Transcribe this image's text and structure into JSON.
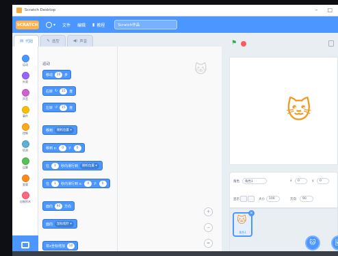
{
  "window": {
    "title": "Scratch Desktop",
    "minimize_label": "–",
    "maximize_label": "□"
  },
  "menubar": {
    "logo_label": "SCRATCH",
    "file_label": "文件",
    "edit_label": "编辑",
    "tutorials_label": "教程",
    "project_title_value": "Scratch作品"
  },
  "tabs": [
    {
      "label": "代码"
    },
    {
      "label": "造型"
    },
    {
      "label": "声音"
    }
  ],
  "categories": [
    {
      "label": "运动",
      "color": "#4c97ff"
    },
    {
      "label": "外观",
      "color": "#9966ff"
    },
    {
      "label": "声音",
      "color": "#cf63cf"
    },
    {
      "label": "事件",
      "color": "#ffbf00"
    },
    {
      "label": "控制",
      "color": "#ffab19"
    },
    {
      "label": "侦测",
      "color": "#5cb1d6"
    },
    {
      "label": "运算",
      "color": "#59c059"
    },
    {
      "label": "变量",
      "color": "#ff8c1a"
    },
    {
      "label": "自制积木",
      "color": "#ff6680"
    }
  ],
  "palette": {
    "title": "运动",
    "blocks": {
      "move": {
        "prefix": "移动",
        "value": "10",
        "suffix": "步"
      },
      "turn_right": {
        "prefix": "右转",
        "icon": "↻",
        "value": "15",
        "suffix": "度"
      },
      "turn_left": {
        "prefix": "左转",
        "icon": "↺",
        "value": "15",
        "suffix": "度"
      },
      "goto": {
        "prefix": "移到",
        "dropdown": "随机位置"
      },
      "goto_xy": {
        "prefix": "移到 x:",
        "x": "0",
        "mid": "y:",
        "y": "0"
      },
      "glide_to": {
        "prefix": "在",
        "value": "1",
        "mid": "秒内滑行到",
        "dropdown": "随机位置"
      },
      "glide_xy": {
        "prefix": "在",
        "value": "1",
        "mid": "秒内滑行到 x:",
        "x": "0",
        "mid2": "y:",
        "y": "0"
      },
      "point_dir": {
        "prefix": "面向",
        "value": "90",
        "suffix": "方向"
      },
      "point_towards": {
        "prefix": "面向",
        "dropdown": "鼠标指针"
      },
      "change_x": {
        "prefix": "将x坐标增加",
        "value": "10"
      }
    }
  },
  "code_area": {
    "zoom_in_label": "+",
    "zoom_out_label": "−",
    "zoom_reset_label": "="
  },
  "stage": {
    "flag_label": "⚑"
  },
  "sprite_info": {
    "sprite_label": "角色",
    "sprite_name_value": "角色1",
    "x_label": "x",
    "x_value": "0",
    "y_label": "y",
    "y_value": "0",
    "show_label": "显示",
    "size_label": "大小",
    "size_value": "100",
    "direction_label": "方向",
    "direction_value": "90"
  },
  "sprite_list": {
    "sprite_name": "角色1",
    "delete_label": "×",
    "add_sprite_label": "🐱",
    "add_backdrop_label": "🖼"
  }
}
